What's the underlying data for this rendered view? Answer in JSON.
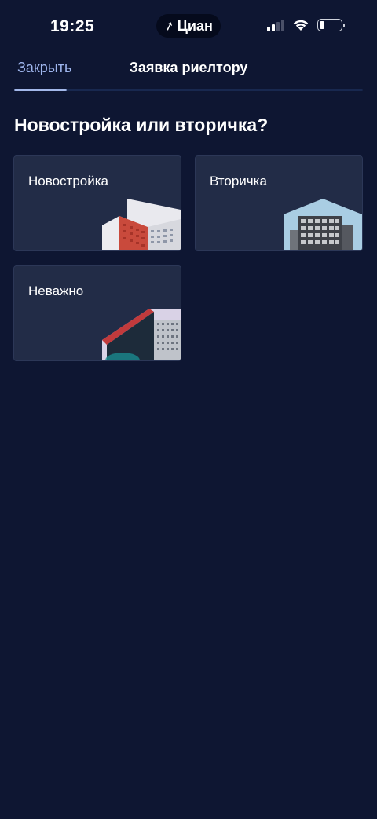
{
  "status_bar": {
    "time": "19:25",
    "app_badge": "Циан"
  },
  "header": {
    "close_label": "Закрыть",
    "title": "Заявка риелтору"
  },
  "progress": {
    "fraction": 0.15
  },
  "question": "Новостройка или вторичка?",
  "options": [
    {
      "label": "Новостройка",
      "image": "new-building-image"
    },
    {
      "label": "Вторичка",
      "image": "secondary-building-image"
    },
    {
      "label": "Неважно",
      "image": "any-building-image"
    }
  ],
  "colors": {
    "background": "#0e1632",
    "card": "#222c47",
    "accent": "#9fb6ee"
  }
}
